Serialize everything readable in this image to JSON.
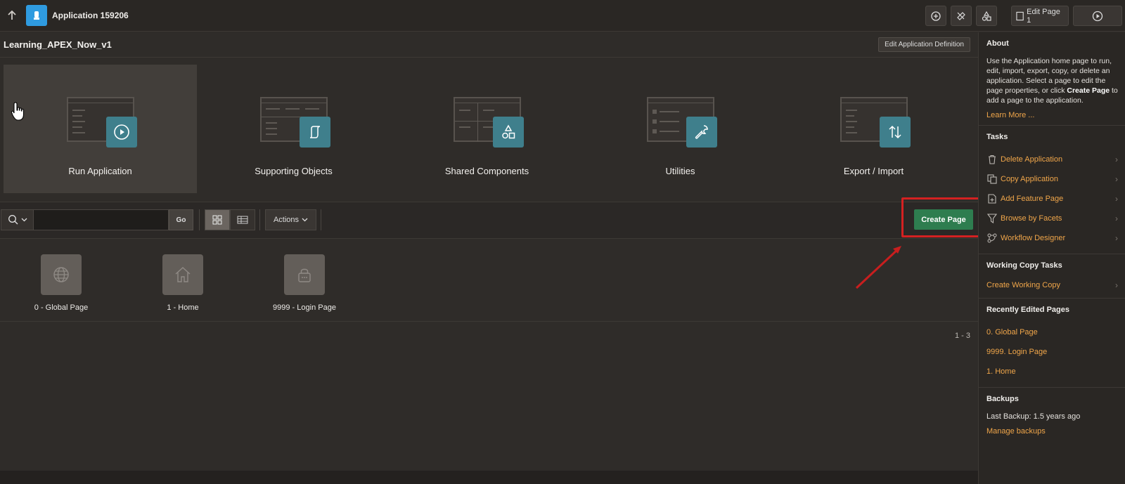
{
  "header": {
    "app_title": "Application 159206",
    "edit_page_label": "Edit Page 1"
  },
  "main": {
    "app_name": "Learning_APEX_Now_v1",
    "edit_definition_label": "Edit Application Definition",
    "tiles": [
      {
        "label": "Run Application"
      },
      {
        "label": "Supporting Objects"
      },
      {
        "label": "Shared Components"
      },
      {
        "label": "Utilities"
      },
      {
        "label": "Export / Import"
      }
    ],
    "search": {
      "value": "",
      "go_label": "Go"
    },
    "actions_label": "Actions",
    "create_page_label": "Create Page",
    "pages": [
      {
        "label": "0 - Global Page",
        "icon": "globe-icon"
      },
      {
        "label": "1 - Home",
        "icon": "home-icon"
      },
      {
        "label": "9999 - Login Page",
        "icon": "lock-icon"
      }
    ],
    "pagination": "1 - 3"
  },
  "sidebar": {
    "about_title": "About",
    "about_text_1": "Use the Application home page to run, edit, import, export, copy, or delete an application. Select a page to edit the page properties, or click ",
    "about_text_bold": "Create Page",
    "about_text_2": " to add a page to the application.",
    "learn_more": "Learn More ...",
    "tasks_title": "Tasks",
    "tasks": [
      {
        "label": "Delete Application",
        "icon": "trash-icon"
      },
      {
        "label": "Copy Application",
        "icon": "copy-icon"
      },
      {
        "label": "Add Feature Page",
        "icon": "file-plus-icon"
      },
      {
        "label": "Browse by Facets",
        "icon": "filter-icon"
      },
      {
        "label": "Workflow Designer",
        "icon": "workflow-icon"
      }
    ],
    "working_copy_title": "Working Copy Tasks",
    "working_copy_link": "Create Working Copy",
    "recent_title": "Recently Edited Pages",
    "recent": [
      "0. Global Page",
      "9999. Login Page",
      "1. Home"
    ],
    "backups_title": "Backups",
    "last_backup": "Last Backup: 1.5 years ago",
    "manage_backups": "Manage backups"
  },
  "colors": {
    "accent_link": "#f0a64a",
    "create_page_green": "#2e7d4f",
    "highlight_red": "#d42121",
    "tile_badge_teal": "#3f7f8c",
    "app_badge_blue": "#2f9be0"
  }
}
